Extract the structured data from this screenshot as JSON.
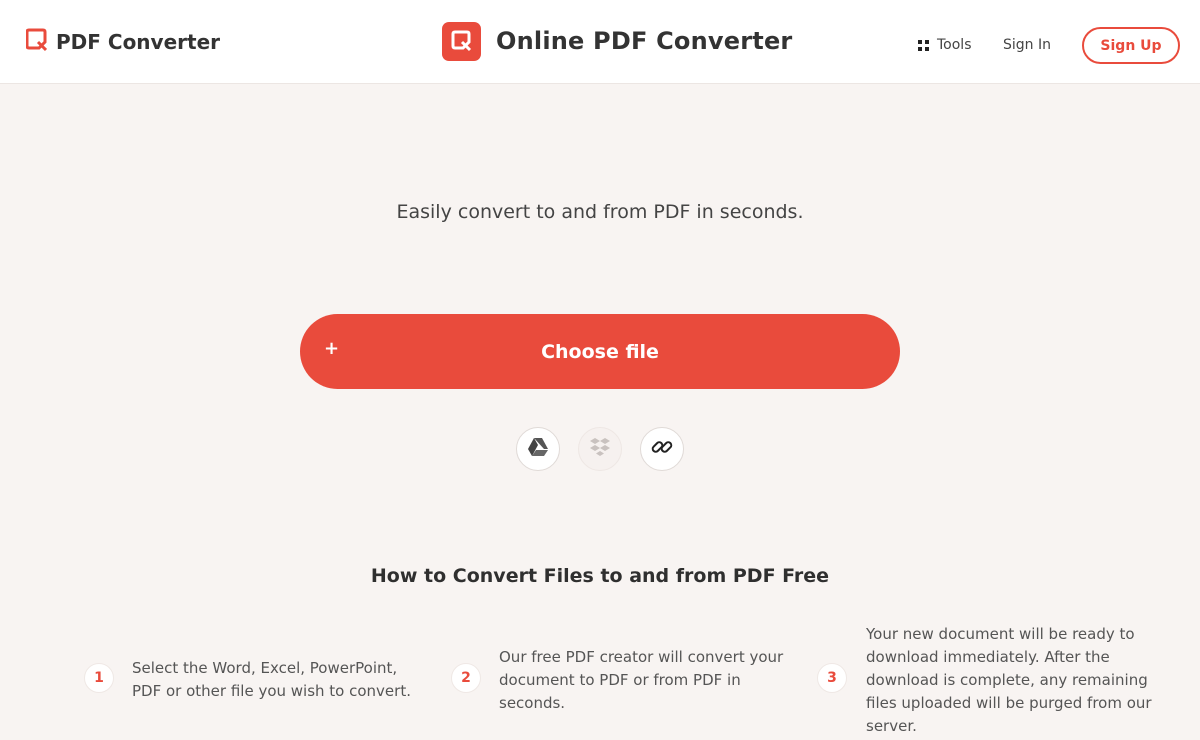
{
  "header": {
    "brand": "PDF Converter",
    "center_title": "Online PDF Converter",
    "tools_label": "Tools",
    "signin_label": "Sign In",
    "signup_label": "Sign Up"
  },
  "hero": {
    "tagline": "Easily convert to and from PDF in seconds.",
    "choose_plus": "+",
    "choose_label": "Choose file"
  },
  "sources": [
    {
      "name": "google-drive",
      "icon": "google-drive-icon"
    },
    {
      "name": "dropbox",
      "icon": "dropbox-icon"
    },
    {
      "name": "link",
      "icon": "link-icon"
    }
  ],
  "howto": {
    "title": "How to Convert Files to and from PDF Free",
    "steps": [
      {
        "number": "1",
        "lines": [
          "Select the Word, Excel, PowerPoint,",
          "PDF or other file you wish to convert."
        ]
      },
      {
        "number": "2",
        "lines": [
          "Our free PDF creator will convert your",
          "document to PDF or from PDF in",
          "seconds."
        ]
      },
      {
        "number": "3",
        "lines": [
          "Your new document will be ready to",
          "download immediately. After the",
          "download is complete, any remaining",
          "files uploaded will be purged from our",
          "server."
        ]
      }
    ]
  },
  "colors": {
    "accent": "#e94b3c",
    "background": "#f8f4f2"
  }
}
